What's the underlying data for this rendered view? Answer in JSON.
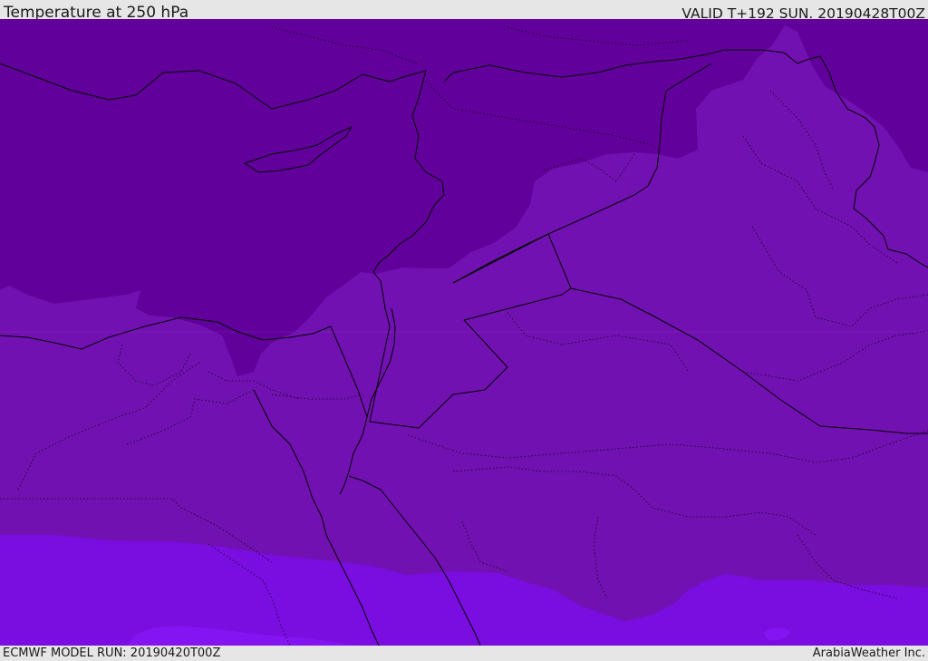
{
  "header": {
    "title": "Temperature at 250 hPa",
    "valid": "VALID T+192 SUN. 20190428T00Z"
  },
  "footer": {
    "model_run": "ECMWF MODEL RUN: 20190420T00Z",
    "credit": "ArabiaWeather Inc."
  },
  "map": {
    "fill_colors": {
      "coldest": "#61009a",
      "cold": "#7211b1",
      "cool": "#7a0ddf",
      "warm": "#8414f2"
    },
    "border_color": "#000000"
  }
}
